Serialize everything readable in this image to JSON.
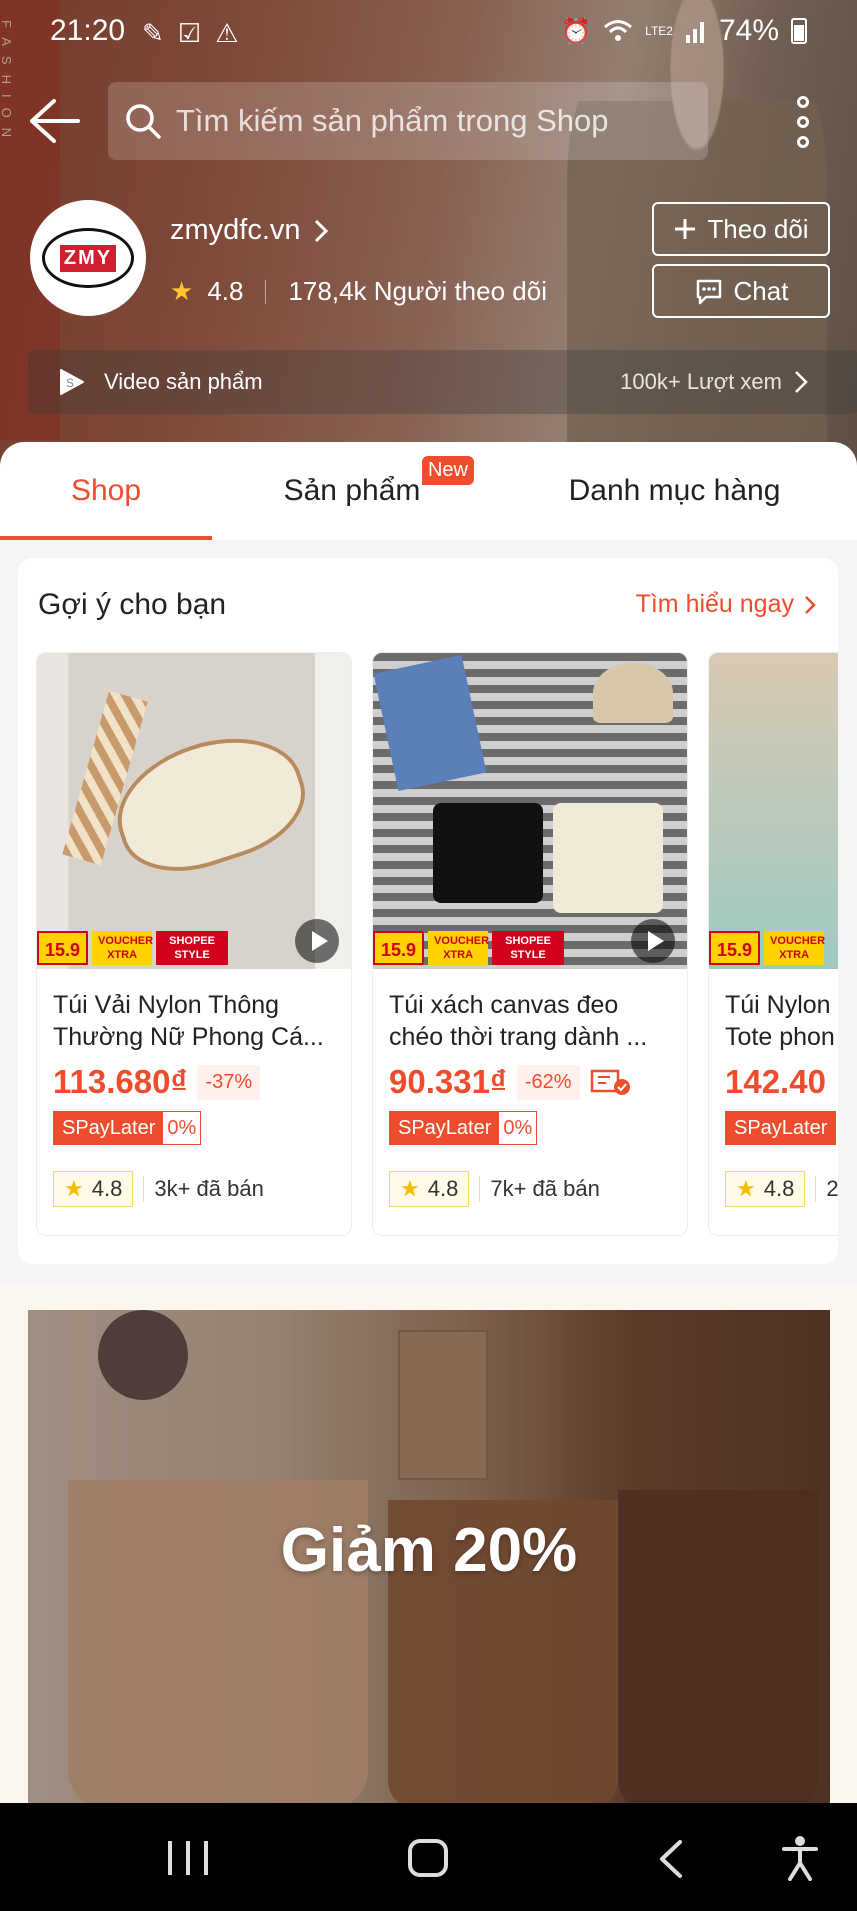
{
  "status_bar": {
    "time": "21:20",
    "battery": "74%",
    "network": "LTE2"
  },
  "header": {
    "background_text": "FASHION",
    "search_placeholder": "Tìm kiếm sản phẩm trong Shop",
    "shop_name": "zmydfc.vn",
    "logo_text": "ZMY",
    "rating": "4.8",
    "followers": "178,4k Người theo dõi",
    "follow_label": "Theo dõi",
    "chat_label": "Chat",
    "video_label": "Video sản phẩm",
    "video_views": "100k+ Lượt xem"
  },
  "tabs": [
    {
      "label": "Shop",
      "active": true
    },
    {
      "label": "Sản phẩm",
      "badge": "New"
    },
    {
      "label": "Danh mục hàng"
    }
  ],
  "suggest": {
    "title": "Gợi ý cho bạn",
    "learn_more": "Tìm hiểu ngay",
    "products": [
      {
        "name_line1": "Túi Vải Nylon Thông",
        "name_line2": "Thường Nữ Phong Cá...",
        "price": "113.680₫",
        "discount": "-37%",
        "spay": "SPayLater",
        "spay_rate": "0%",
        "rating": "4.8",
        "sold": "3k+ đã bán",
        "promo_price": "15.9",
        "promo_voucher": "VOUCHER XTRA",
        "promo_style": "SHOPEE STYLE"
      },
      {
        "name_line1": "Túi xách canvas đeo",
        "name_line2": "chéo thời trang dành ...",
        "price": "90.331₫",
        "discount": "-62%",
        "spay": "SPayLater",
        "spay_rate": "0%",
        "rating": "4.8",
        "sold": "7k+ đã bán",
        "promo_price": "15.9",
        "promo_voucher": "VOUCHER XTRA",
        "promo_style": "SHOPEE STYLE"
      },
      {
        "name_line1": "Túi Nylon",
        "name_line2": "Tote phon",
        "price": "142.40",
        "spay": "SPayLater",
        "rating": "4.8",
        "sold": "2",
        "promo_price": "15.9",
        "promo_voucher": "VOUCHER XTRA"
      }
    ]
  },
  "banner": {
    "text": "Giảm 20%"
  },
  "colors": {
    "accent": "#ee4d2d",
    "star": "#ffb800"
  }
}
